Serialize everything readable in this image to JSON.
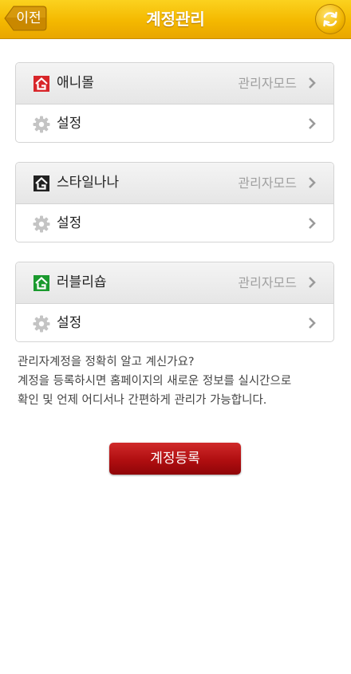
{
  "header": {
    "back_label": "이전",
    "title": "계정관리",
    "refresh_icon": "refresh-icon"
  },
  "accounts": [
    {
      "name": "애니몰",
      "mode": "관리자모드",
      "setting_label": "설정",
      "icon_color": "#d8262a"
    },
    {
      "name": "스타일나나",
      "mode": "관리자모드",
      "setting_label": "설정",
      "icon_color": "#222222"
    },
    {
      "name": "러블리숍",
      "mode": "관리자모드",
      "setting_label": "설정",
      "icon_color": "#1a9a2e"
    }
  ],
  "info": {
    "line1": "관리자계정을 정확히 알고 계신가요?",
    "line2": "계정을 등록하시면 홈페이지의 새로운 정보를 실시간으로",
    "line3": "확인 및 언제 어디서나 간편하게 관리가 가능합니다."
  },
  "register_label": "계정등록",
  "colors": {
    "header": "#f4b800",
    "register_button": "#b00e10",
    "mode_text": "#a0a0a0"
  }
}
